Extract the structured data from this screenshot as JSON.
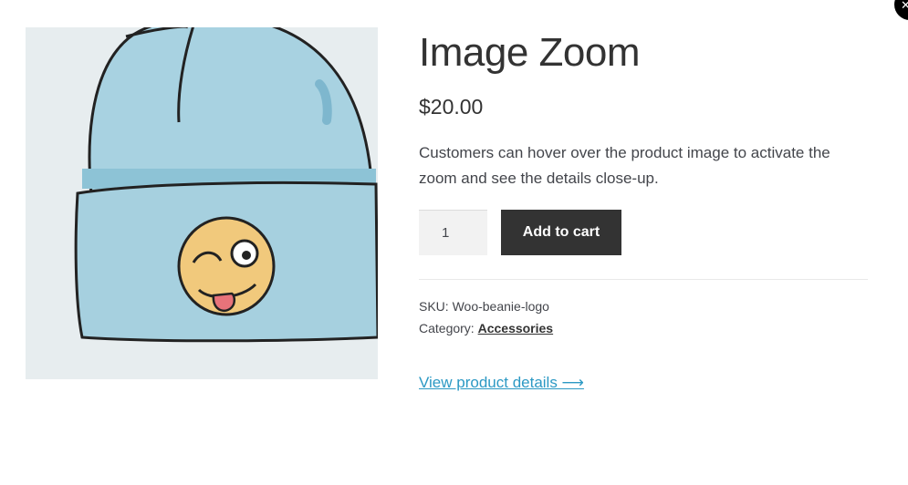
{
  "modal": {
    "close_symbol": "✕"
  },
  "product": {
    "title": "Image Zoom",
    "price": "$20.00",
    "description": "Customers can hover over the product image to activate the zoom and see the details close-up.",
    "quantity": "1",
    "add_to_cart_label": "Add to cart",
    "sku_label": "SKU:",
    "sku_value": "Woo-beanie-logo",
    "category_label": "Category:",
    "category_value": "Accessories",
    "view_details_label": "View product details ⟶"
  },
  "colors": {
    "button_bg": "#333333",
    "link": "#2c99c4",
    "beanie": "#9ccbdc",
    "image_bg": "#e7edef"
  },
  "icons": {
    "close": "close-icon",
    "image": "beanie-with-emoji-logo"
  }
}
